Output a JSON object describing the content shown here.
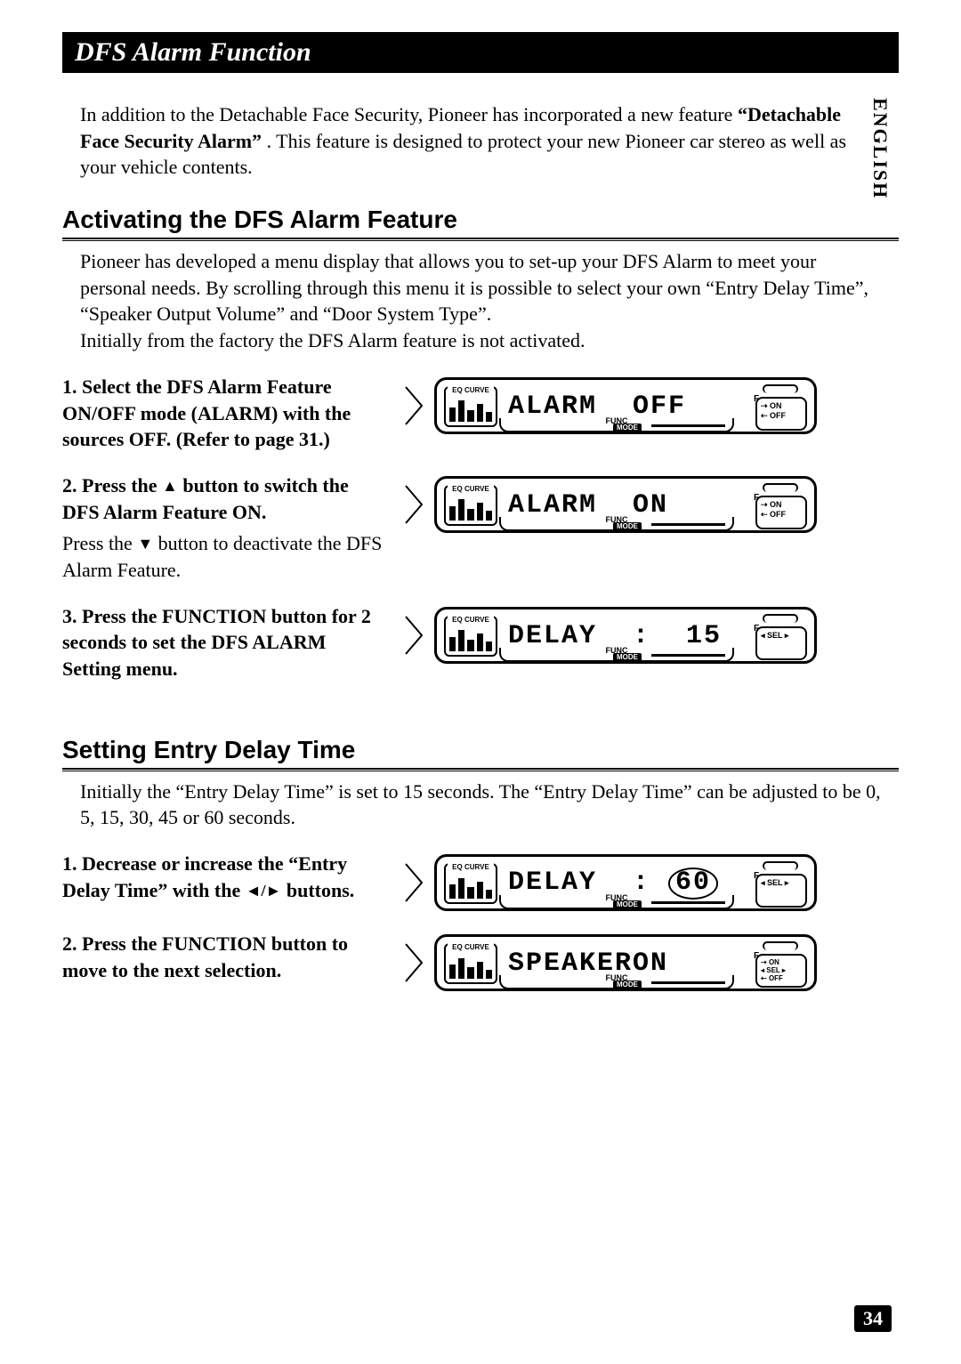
{
  "page": {
    "title": "DFS Alarm Function",
    "language_tab": "ENGLISH",
    "page_number": "34"
  },
  "intro": {
    "line1": "In addition to the Detachable Face Security, Pioneer has incorporated a new feature ",
    "bold": "“Detachable Face Security Alarm”",
    "line2": ". This feature is designed to protect your new Pioneer car stereo as well as your vehicle contents."
  },
  "section1": {
    "heading": "Activating the DFS Alarm Feature",
    "body": "Pioneer has developed a menu display that allows you to set-up your DFS Alarm to meet your personal needs. By scrolling through this menu it is possible to select your own “Entry Delay Time”, “Speaker Output Volume” and “Door System Type”.\nInitially from the factory the DFS Alarm feature is not activated.",
    "steps": [
      {
        "num": "1.",
        "bold": "Select the DFS Alarm Feature ON/OFF mode (ALARM) with the sources OFF. (Refer to page 31.)",
        "sub": "",
        "lcd": "ALARM  OFF",
        "circled": false,
        "indicator": "onoff"
      },
      {
        "num": "2.",
        "bold_pre": "Press the ",
        "glyph": "▲",
        "bold_post": " button to switch the DFS Alarm Feature ON.",
        "sub_pre": "Press the ",
        "sub_glyph": "▼",
        "sub_post": " button to deactivate the DFS Alarm Feature.",
        "lcd": "ALARM  ON",
        "circled": false,
        "indicator": "onoff"
      },
      {
        "num": "3.",
        "bold": "Press the FUNCTION button for 2 seconds to set the DFS ALARM Setting menu.",
        "sub": "",
        "lcd_pre": "DELAY  :  ",
        "lcd_val": "15",
        "circled": false,
        "indicator": "sel"
      }
    ]
  },
  "section2": {
    "heading": "Setting Entry Delay Time",
    "body": "Initially the “Entry Delay Time” is set to 15 seconds. The “Entry Delay Time” can be adjusted to be 0, 5, 15, 30, 45 or 60 seconds.",
    "steps": [
      {
        "num": "1.",
        "bold_pre": "Decrease or increase the “Entry Delay Time” with the ",
        "glyph": "◄/►",
        "bold_post": " buttons.",
        "sub": "",
        "lcd_pre": "DELAY  : ",
        "lcd_val": "60",
        "circled": true,
        "indicator": "sel"
      },
      {
        "num": "2.",
        "bold": "Press the FUNCTION button to move to the next selection.",
        "sub": "",
        "lcd": "SPEAKERON",
        "circled": false,
        "indicator": "selonoff"
      }
    ]
  },
  "lcd_labels": {
    "eq": "EQ CURVE",
    "func": "FUNC",
    "mode": "MODE",
    "f": "F",
    "on": "ON",
    "off": "OFF",
    "sel": "SEL"
  }
}
